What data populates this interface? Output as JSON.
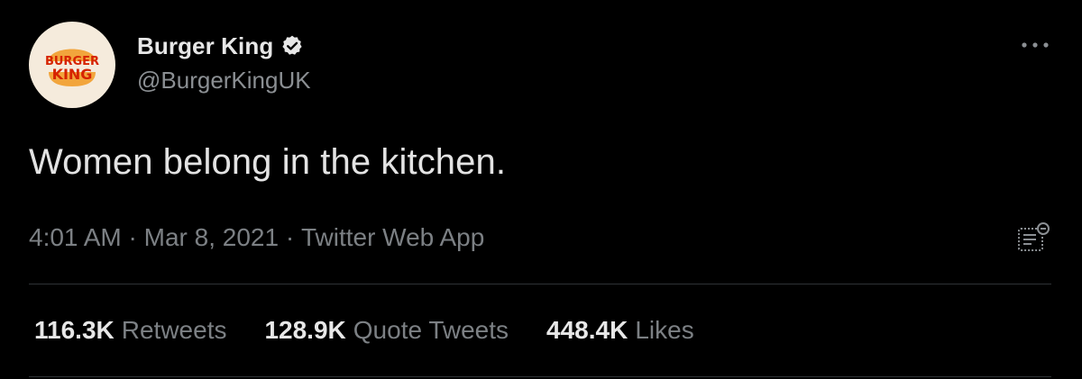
{
  "tweet": {
    "avatar": {
      "logo_line1": "BURGER",
      "logo_line2": "KING",
      "brand_colors": {
        "background": "#f5ebdc",
        "bun": "#f2a53c",
        "text": "#d62300"
      }
    },
    "display_name": "Burger King",
    "verified_icon": "verified-badge-icon",
    "handle": "@BurgerKingUK",
    "more_icon": "more-horizontal-icon",
    "text": "Women belong in the kitchen.",
    "meta": {
      "time": "4:01 AM",
      "separator": " · ",
      "date": "Mar 8, 2021",
      "source": "Twitter Web App"
    },
    "analytics_icon": "tweet-analytics-icon",
    "stats": [
      {
        "count": "116.3K",
        "label": "Retweets"
      },
      {
        "count": "128.9K",
        "label": "Quote Tweets"
      },
      {
        "count": "448.4K",
        "label": "Likes"
      }
    ]
  }
}
